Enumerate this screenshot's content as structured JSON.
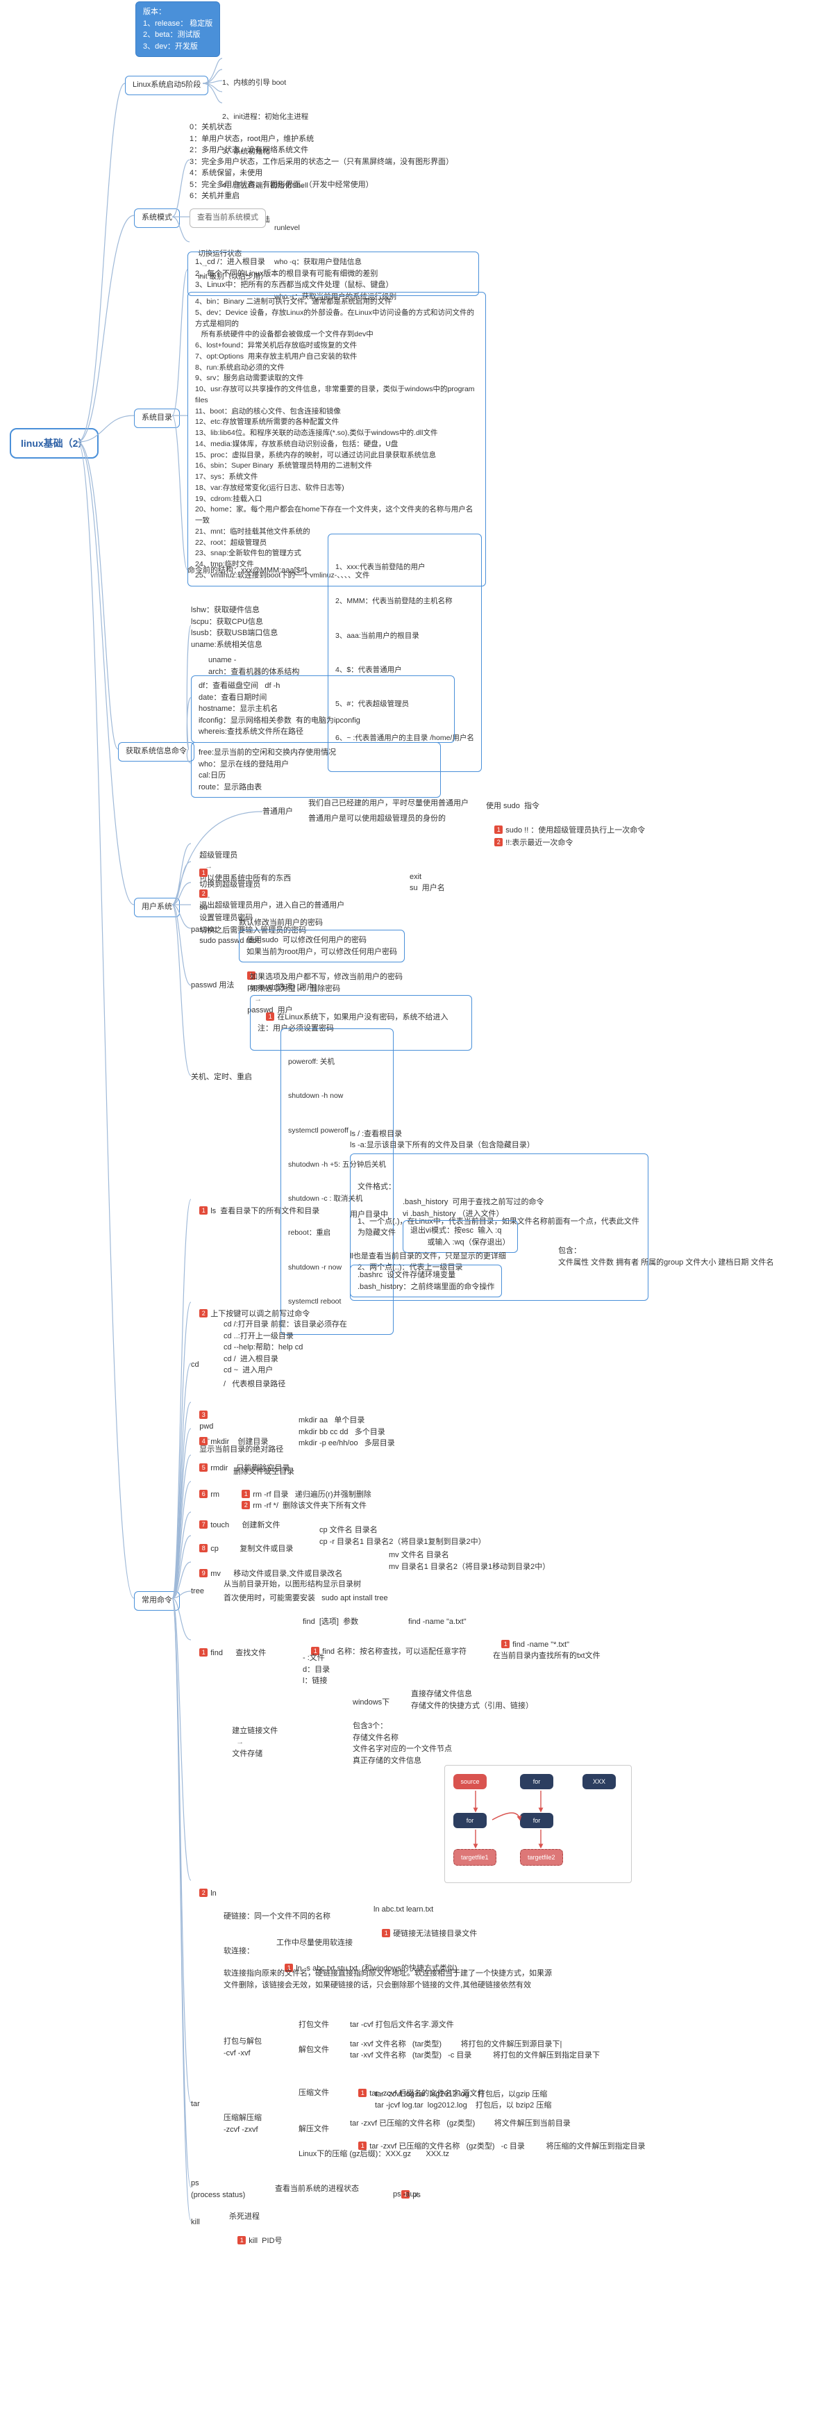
{
  "root": "linux基础（2）",
  "version_box": "版本：\n1、release： 稳定版\n2、beta：测试版\n3、dev：开发版",
  "sec_boot": {
    "title": "Linux系统启动5阶段",
    "items": [
      "1、内核的引导 boot",
      "2、init进程：初始化主进程",
      "3、系统初始化",
      "4、建立终端，初始化Shell",
      "5、初始化登陆"
    ]
  },
  "sec_mode": {
    "title": "系统模式",
    "status_block": "0：关机状态\n1：单用户状态，root用户，维护系统\n2：多用户状态，没有网络系统文件\n3：完全多用户状态，工作后采用的状态之一（只有黑屏终端，没有图形界面）\n4：系统保留，未使用\n5：完全多用户状态，有图形界面。（开发中经常使用）\n6：关机并重启",
    "view_label": "查看当前系统模式",
    "view_items": [
      "runlevel",
      "who -q：获取用户登陆信息",
      "who -r：获取当前用户的系统运行级别"
    ],
    "switch": "切换运行状态",
    "switch_val": "init 级别（以后少用）"
  },
  "sec_dir": {
    "title": "系统目录",
    "intro_block": "1、cd /：进入根目录\n2、每个不同的Linux版本的根目录有可能有细微的差别\n3、Linux中：把所有的东西都当成文件处理（鼠标、键盘）",
    "list_block": "4、bin：Binary 二进制可执行文件。通常都是系统启用的文件\n5、dev：Device 设备，存放Linux的外部设备。在Linux中访问设备的方式和访问文件的方式是相同的\n   所有系统硬件中的设备都会被做成一个文件存到dev中\n6、lost+found：异常关机后存放临时或恢复的文件\n7、opt:Options  用来存放主机用户自己安装的软件\n8、run:系统启动必须的文件\n9、srv：服务启动需要读取的文件\n10、usr:存放可以共享操作的文件信息，非常重要的目录，类似于windows中的program files\n11、boot：启动的核心文件、包含连接和镜像\n12、etc:存放管理系统所需要的各种配置文件\n13、lib:lib64位。和程序关联的动态连接库(*.so),类似于windows中的.dll文件\n14、media:媒体库，存放系统自动识别设备，包括：硬盘，U盘\n15、proc：虚拟目录，系统内存的映射，可以通过访问此目录获取系统信息\n16、sbin：Super Binary  系统管理员特用的二进制文件\n17、sys：系统文件\n18、var:存放经常变化(运行日志、软件日志等)\n19、cdrom:挂载入口\n20、home：家。每个用户都会在home下存在一个文件夹，这个文件夹的名称与用户名一致\n21、mnt：临时挂载其他文件系统的\n22、root：超级管理员\n23、snap:全新软件包的管理方式\n24、tmp:临时文件\n25、vmlinuz:软连接到boot下的一个vmlinuz-、、、、文件",
    "cmdline_title": "命令前的结构：xxx@MMM:aaa[$#]",
    "cmdline_items": [
      "1、xxx:代表当前登陆的用户",
      "2、MMM：代表当前登陆的主机名称",
      "3、aaa:当前用户的根目录",
      "4、$：代表普通用户",
      "5、#：代表超级管理员",
      "6、~ :代表普通用户的主目录   /home/用户名"
    ]
  },
  "sec_info": {
    "title": "获取系统信息命令",
    "block1": "lshw：获取硬件信息\nlscpu：获取CPU信息\nlsusb：获取USB端口信息\nuname:系统相关信息",
    "uname": "uname -\narch：查看机器的体系结构",
    "block2": "df：查看磁盘空间   df -h\ndate：查看日期时间\nhostname：显示主机名\nifconfig：显示网络相关参数  有的电脑为ipconfig\nwhereis:查找系统文件所在路径",
    "block3": "free:显示当前的空闲和交换内存使用情况\nwho：显示在线的登陆用户\ncal:日历\nroute：显示路由表"
  },
  "sec_user": {
    "title": "用户系统",
    "normal_user": {
      "label": "普通用户",
      "lines": [
        "我们自己已经建的用户，平时尽量使用普通用户",
        "普通用户是可以使用超级管理员的身份的"
      ],
      "sudo": "使用 sudo  指令",
      "sudo_items": [
        "sudo !! ：使用超级管理员执行上一次命令",
        "!!:表示最近一次命令"
      ]
    },
    "admin": {
      "label": "超级管理员",
      "note": "可以使用系统中所有的东西"
    },
    "switch_admin": {
      "label": "切换到超级管理员",
      "cmd": "su",
      "note": "切换之后需要输入管理员的密码"
    },
    "exit_admin": {
      "label": "退出超级管理员用户，进入自己的普通用户",
      "items": [
        "exit",
        "su  用户名"
      ]
    },
    "set_admin_pwd": {
      "label": "设置管理员密码",
      "cmd": "sudo passwd root"
    },
    "passwd": {
      "label": "passwd",
      "l1": "默认修改当前用户的密码",
      "l2": "使用sudo  可以修改任何用户的密码\n如果当前为root用户，可以修改任何用户密码",
      "l3": "passwd [选项] [用户]",
      "l3r": "passwd  用户",
      "usage_label": "passwd 用法",
      "u1": "如果选项及用户都不写，修改当前用户的密码\n如果选项为空 -i：删除密码",
      "u2": "在Linux系统下，如果用户没有密码，系统不给进入\n注：用户必须设置密码"
    },
    "shutdown": {
      "label": "关机、定时、重启",
      "items": [
        "poweroff: 关机",
        "shutdown -h now",
        "systemctl poweroff",
        "shutodwn -h +5: 五分钟后关机",
        "shutdown -c : 取消关机",
        "reboot：重启",
        "shutdown -r now",
        "systemctl reboot"
      ]
    }
  },
  "sec_cmd": {
    "title": "常用命令",
    "ls": {
      "label": "ls  查看目录下的所有文件和目录",
      "top": [
        "ls / :查看根目录",
        "ls -a:显示该目录下所有的文件及目录（包含隐藏目录）"
      ],
      "fmt_title": "文件格式：",
      "fmt": [
        "1、一个点(.)，在Linux中，代表当前目录，如果文件名称前面有一个点，代表此文件为隐藏文件",
        "2、两个点(..)：代表上一级目录"
      ],
      "user_dir_label": "用户目录中",
      "user_dir_items": [
        ".bash_history  可用于查找之前写过的命令\nvi .bash_history （进入文件）",
        "退出vi模式：按esc  输入 :q\n        或输入 :wq（保存退出）"
      ],
      "llabel": "ll也是查看当前目录的文件，只是显示的更详细",
      "ll_right": "包含：\n文件属性 文件数 拥有者 所属的group 文件大小 建档日期 文件名",
      "bashrc": ".bashrc  设文件存储环境变量\n.bash_history：之前终端里面的命令操作",
      "updown": "上下按键可以调之前写过命令"
    },
    "cd": {
      "label": "cd",
      "list": "cd /:打开目录 前提：该目录必须存在\ncd ..:打开上一级目录\ncd --help:帮助：help cd\ncd /  进入根目录\ncd ~  进入用户",
      "root": "/   代表根目录路径"
    },
    "pwd": {
      "label": "pwd",
      "note": "显示当前目录的绝对路径"
    },
    "mkdir": {
      "label": "mkdir    创建目录",
      "r1": "mkdir aa   单个目录\nmkdir bb cc dd   多个目录\nmkdir -p ee/hh/oo   多层目录"
    },
    "rmdir": {
      "label": "rmdir    只能删除空目录"
    },
    "rm": {
      "label": "rm",
      "top": "删除文件或空目录",
      "r1": "rm -rf 目录   递归遍历(r)并强制删除",
      "r2": "rm -rf */  删除该文件夹下所有文件"
    },
    "touch": {
      "label": "touch      创建新文件"
    },
    "cp": {
      "label": "cp          复制文件或目录",
      "r1": "cp 文件名 目录名\ncp -r 目录名1 目录名2（将目录1复制到目录2中）"
    },
    "mv": {
      "label": "mv      移动文件或目录,文件或目录改名",
      "r1": "mv 文件名 目录名\nmv 目录名1 目录名2（将目录1移动到目录2中）"
    },
    "tree": {
      "label": "tree",
      "l1": "从当前目录开始，以图形结构显示目录树",
      "l2": "首次使用时，可能需要安装   sudo apt install tree"
    },
    "find": {
      "label": "find      查找文件",
      "fmt": "find  [选项]  参数",
      "fmt2": "find 名称：按名称查找，可以适配任意字符",
      "ex": "find -name \"a.txt\"",
      "ex2": "find -name \"*.txt\"\n在当前目录内查找所有的txt文件",
      "last": "- :文件\nd：目录\nl：链接"
    },
    "ln": {
      "label": "ln",
      "top_label": "建立链接文件",
      "store": "文件存储",
      "win": "windows下",
      "win_r": "直接存储文件信息\n存储文件的快捷方式（引用、链接）",
      "linux": "包含3个：\n存储文件名称\n文件名字对应的一个文件节点\n真正存储的文件信息",
      "hard_label": "硬链接：同一个文件不同的名称",
      "hard_r1": "ln abc.txt learn.txt",
      "hard_r2": "硬链接无法链接目录文件",
      "soft_label": "软连接：",
      "soft_r0": "工作中尽量使用软连接",
      "soft_r1": "ln -s abc.txt stu.txt  (和windows的快捷方式类似)",
      "soft_desc": "软连接指向原来的文件名，硬链接直接指向原文件地址。软连接相当于建了一个快捷方式，如果源文件删除，该链接会无效，如果硬链接的话，只会删除那个链接的文件,其他硬链接依然有效"
    },
    "tar": {
      "label": "tar",
      "pack_label": "打包与解包\n-cvf -xvf",
      "pack": {
        "l": "打包文件",
        "r": "tar -cvf 打包后文件名字.源文件"
      },
      "unpack": {
        "l": "解包文件",
        "items": [
          "tar -xvf 文件名称   (tar类型)         将打包的文件解压到源目录下|",
          "tar -xvf 文件名称   (tar类型)   -c 目录          将打包的文件解压到指定目录下"
        ]
      },
      "zip_label": "压缩解压缩\n-zcvf -zxvf",
      "zip": {
        "l": "压缩文件",
        "top": "tar -zcvf 后缀名的文件名字.源文件",
        "items": [
          "tar -zcvf log.tar  log2012.log    打包后，以gzip 压缩",
          "tar -jcvf log.tar  log2012.log    打包后，以 bzip2 压缩"
        ]
      },
      "unzip": {
        "l": "解压文件",
        "items": [
          "tar -zxvf 已压缩的文件名称   (gz类型)         将文件解压到当前目录",
          "tar -zxvf 已压缩的文件名称   (gz类型)   -c 目录          将压缩的文件解压到指定目录"
        ]
      },
      "gz": "Linux下的压缩 (gz后缀)：XXX.gz       XXX.tz"
    },
    "ps": {
      "label": "ps\n(process status)",
      "r": "查看当前系统的进程状态",
      "items": [
        "ps",
        "ps -aux"
      ]
    },
    "kill": {
      "label": "kill",
      "r": "杀死进程",
      "item": "kill  PID号"
    }
  },
  "diagram": {
    "a": "source",
    "b": "for",
    "c": "XXX",
    "d": "targetfile1",
    "e": "targetfile2"
  }
}
